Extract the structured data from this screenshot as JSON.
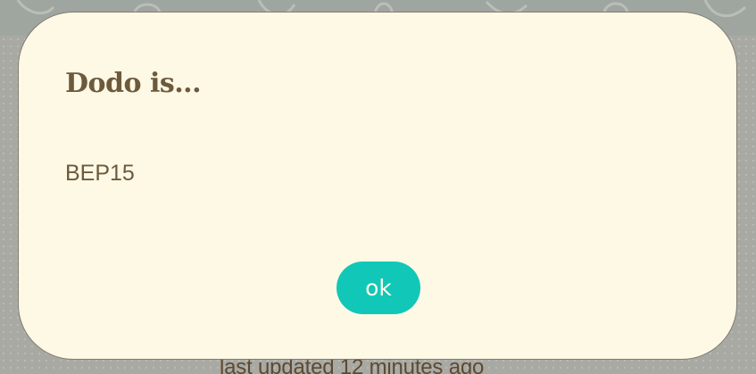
{
  "background": {
    "status_text": "last updated 12 minutes ago"
  },
  "dialog": {
    "title": "Dodo is...",
    "message": "BEP15",
    "ok_label": "ok"
  },
  "colors": {
    "dialog_background": "#fef9e5",
    "text": "#6d5a3d",
    "button": "#11c7b8",
    "button_text": "#fffaea",
    "overlay": "#a9a9a4"
  }
}
